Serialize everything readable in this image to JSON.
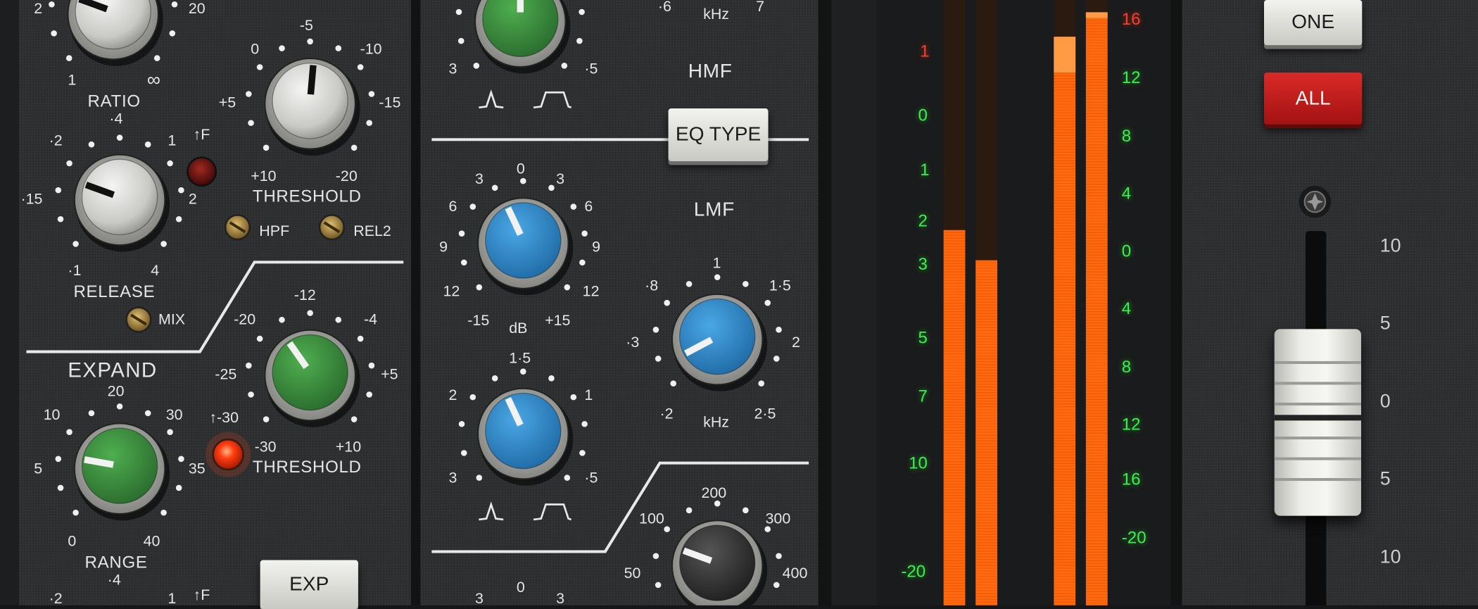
{
  "dynamics": {
    "ratio": {
      "label": "RATIO",
      "scale": [
        "2",
        "20",
        "1",
        "∞"
      ]
    },
    "threshold_comp": {
      "label": "THRESHOLD",
      "scale": [
        "0",
        "-5",
        "-10",
        "+5",
        "-15",
        "+10",
        "-20"
      ]
    },
    "release": {
      "label": "RELEASE",
      "scale": [
        "·4",
        "·2",
        "1",
        "·15",
        "2",
        "·1",
        "4"
      ]
    },
    "fast_attack_indicator": "↑F",
    "hpf_label": "HPF",
    "rel2_label": "REL2",
    "mix_label": "MIX",
    "expand": {
      "label": "EXPAND"
    },
    "range": {
      "label": "RANGE",
      "scale": [
        "20",
        "10",
        "30",
        "5",
        "35",
        "0",
        "40"
      ]
    },
    "threshold_exp": {
      "label": "THRESHOLD",
      "scale": [
        "-12",
        "-20",
        "-4",
        "-25",
        "+5",
        "-30",
        "+10"
      ]
    },
    "exp_indicator": "↑-30",
    "exp_button": "EXP",
    "bottom_scale": [
      "·2",
      "·4",
      "1",
      "↑F"
    ]
  },
  "eq": {
    "hmf": {
      "label": "HMF",
      "khz_label": "kHz",
      "freq_scale": [
        "·6",
        "7"
      ],
      "q_scale": [
        "3",
        "·5"
      ]
    },
    "eq_type_button": "EQ TYPE",
    "lmf": {
      "label": "LMF",
      "khz_label": "kHz",
      "freq_scale": [
        "1",
        "·8",
        "1·5",
        "·3",
        "2",
        "·2",
        "2·5"
      ]
    },
    "gain": {
      "unit": "dB",
      "scale": [
        "3",
        "0",
        "3",
        "6",
        "6",
        "9",
        "9",
        "12",
        "12",
        "-15",
        "+15"
      ]
    },
    "lmf_q": {
      "scale": [
        "1·5",
        "2",
        "1",
        "3",
        "·5"
      ]
    },
    "hpf": {
      "scale": [
        "200",
        "100",
        "300",
        "50",
        "400"
      ]
    },
    "bottom_scale": [
      "3",
      "0",
      "3"
    ]
  },
  "meter": {
    "left_scale": [
      "1",
      "0",
      "1",
      "2",
      "3",
      "5",
      "7",
      "10",
      "-20"
    ],
    "right_scale": [
      "16",
      "12",
      "8",
      "4",
      "0",
      "4",
      "8",
      "12",
      "16",
      "-20"
    ],
    "levels": [
      0.62,
      0.57,
      0.94,
      0.98
    ],
    "peaks": [
      0.0,
      0.0,
      0.88,
      0.97
    ]
  },
  "fader": {
    "one_button": "ONE",
    "all_button": "ALL",
    "scale": [
      "10",
      "5",
      "0",
      "5",
      "10"
    ]
  }
}
